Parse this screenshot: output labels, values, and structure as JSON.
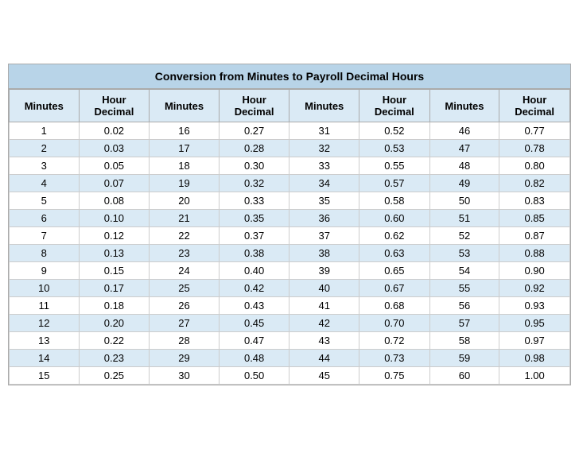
{
  "title": "Conversion from Minutes to Payroll Decimal Hours",
  "headers": [
    {
      "col1": "Minutes",
      "col2": "Hour\nDecimal"
    },
    {
      "col1": "Minutes",
      "col2": "Hour\nDecimal"
    },
    {
      "col1": "Minutes",
      "col2": "Hour\nDecimal"
    },
    {
      "col1": "Minutes",
      "col2": "Hour\nDecimal"
    }
  ],
  "rows": [
    {
      "m1": "1",
      "d1": "0.02",
      "m2": "16",
      "d2": "0.27",
      "m3": "31",
      "d3": "0.52",
      "m4": "46",
      "d4": "0.77"
    },
    {
      "m1": "2",
      "d1": "0.03",
      "m2": "17",
      "d2": "0.28",
      "m3": "32",
      "d3": "0.53",
      "m4": "47",
      "d4": "0.78"
    },
    {
      "m1": "3",
      "d1": "0.05",
      "m2": "18",
      "d2": "0.30",
      "m3": "33",
      "d3": "0.55",
      "m4": "48",
      "d4": "0.80"
    },
    {
      "m1": "4",
      "d1": "0.07",
      "m2": "19",
      "d2": "0.32",
      "m3": "34",
      "d3": "0.57",
      "m4": "49",
      "d4": "0.82"
    },
    {
      "m1": "5",
      "d1": "0.08",
      "m2": "20",
      "d2": "0.33",
      "m3": "35",
      "d3": "0.58",
      "m4": "50",
      "d4": "0.83"
    },
    {
      "m1": "6",
      "d1": "0.10",
      "m2": "21",
      "d2": "0.35",
      "m3": "36",
      "d3": "0.60",
      "m4": "51",
      "d4": "0.85"
    },
    {
      "m1": "7",
      "d1": "0.12",
      "m2": "22",
      "d2": "0.37",
      "m3": "37",
      "d3": "0.62",
      "m4": "52",
      "d4": "0.87"
    },
    {
      "m1": "8",
      "d1": "0.13",
      "m2": "23",
      "d2": "0.38",
      "m3": "38",
      "d3": "0.63",
      "m4": "53",
      "d4": "0.88"
    },
    {
      "m1": "9",
      "d1": "0.15",
      "m2": "24",
      "d2": "0.40",
      "m3": "39",
      "d3": "0.65",
      "m4": "54",
      "d4": "0.90"
    },
    {
      "m1": "10",
      "d1": "0.17",
      "m2": "25",
      "d2": "0.42",
      "m3": "40",
      "d3": "0.67",
      "m4": "55",
      "d4": "0.92"
    },
    {
      "m1": "11",
      "d1": "0.18",
      "m2": "26",
      "d2": "0.43",
      "m3": "41",
      "d3": "0.68",
      "m4": "56",
      "d4": "0.93"
    },
    {
      "m1": "12",
      "d1": "0.20",
      "m2": "27",
      "d2": "0.45",
      "m3": "42",
      "d3": "0.70",
      "m4": "57",
      "d4": "0.95"
    },
    {
      "m1": "13",
      "d1": "0.22",
      "m2": "28",
      "d2": "0.47",
      "m3": "43",
      "d3": "0.72",
      "m4": "58",
      "d4": "0.97"
    },
    {
      "m1": "14",
      "d1": "0.23",
      "m2": "29",
      "d2": "0.48",
      "m3": "44",
      "d3": "0.73",
      "m4": "59",
      "d4": "0.98"
    },
    {
      "m1": "15",
      "d1": "0.25",
      "m2": "30",
      "d2": "0.50",
      "m3": "45",
      "d3": "0.75",
      "m4": "60",
      "d4": "1.00"
    }
  ]
}
